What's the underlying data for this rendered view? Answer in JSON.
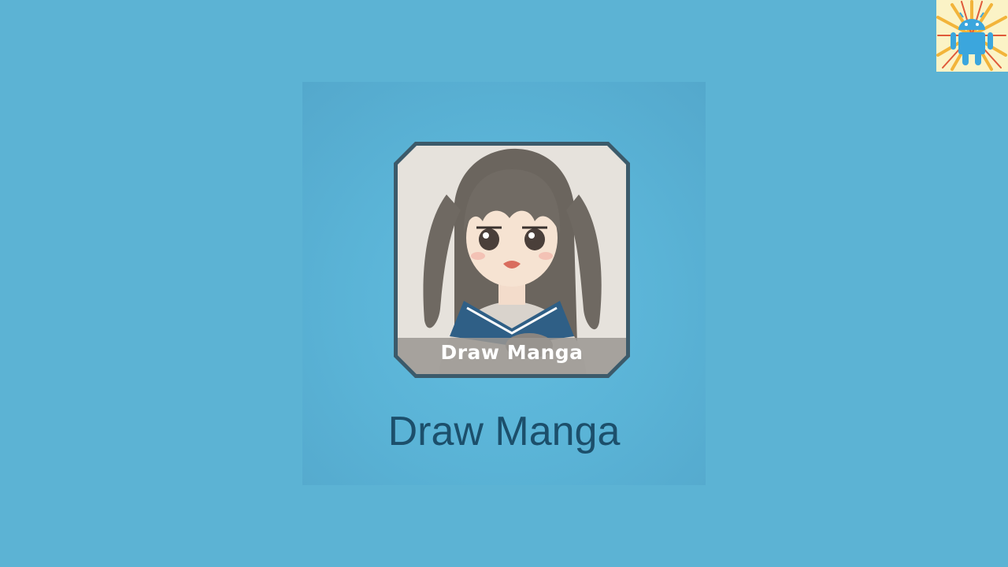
{
  "app": {
    "title": "Draw Manga",
    "icon_label": "Draw Manga",
    "icon_name": "manga-girl-icon"
  },
  "badge": {
    "icon_name": "android-robot-icon"
  },
  "colors": {
    "background": "#5cb3d4",
    "title_text": "#1c4f6b",
    "icon_border": "#3c5a6a",
    "badge_background": "#fbf3c6",
    "android_blue": "#3ba6dd"
  }
}
